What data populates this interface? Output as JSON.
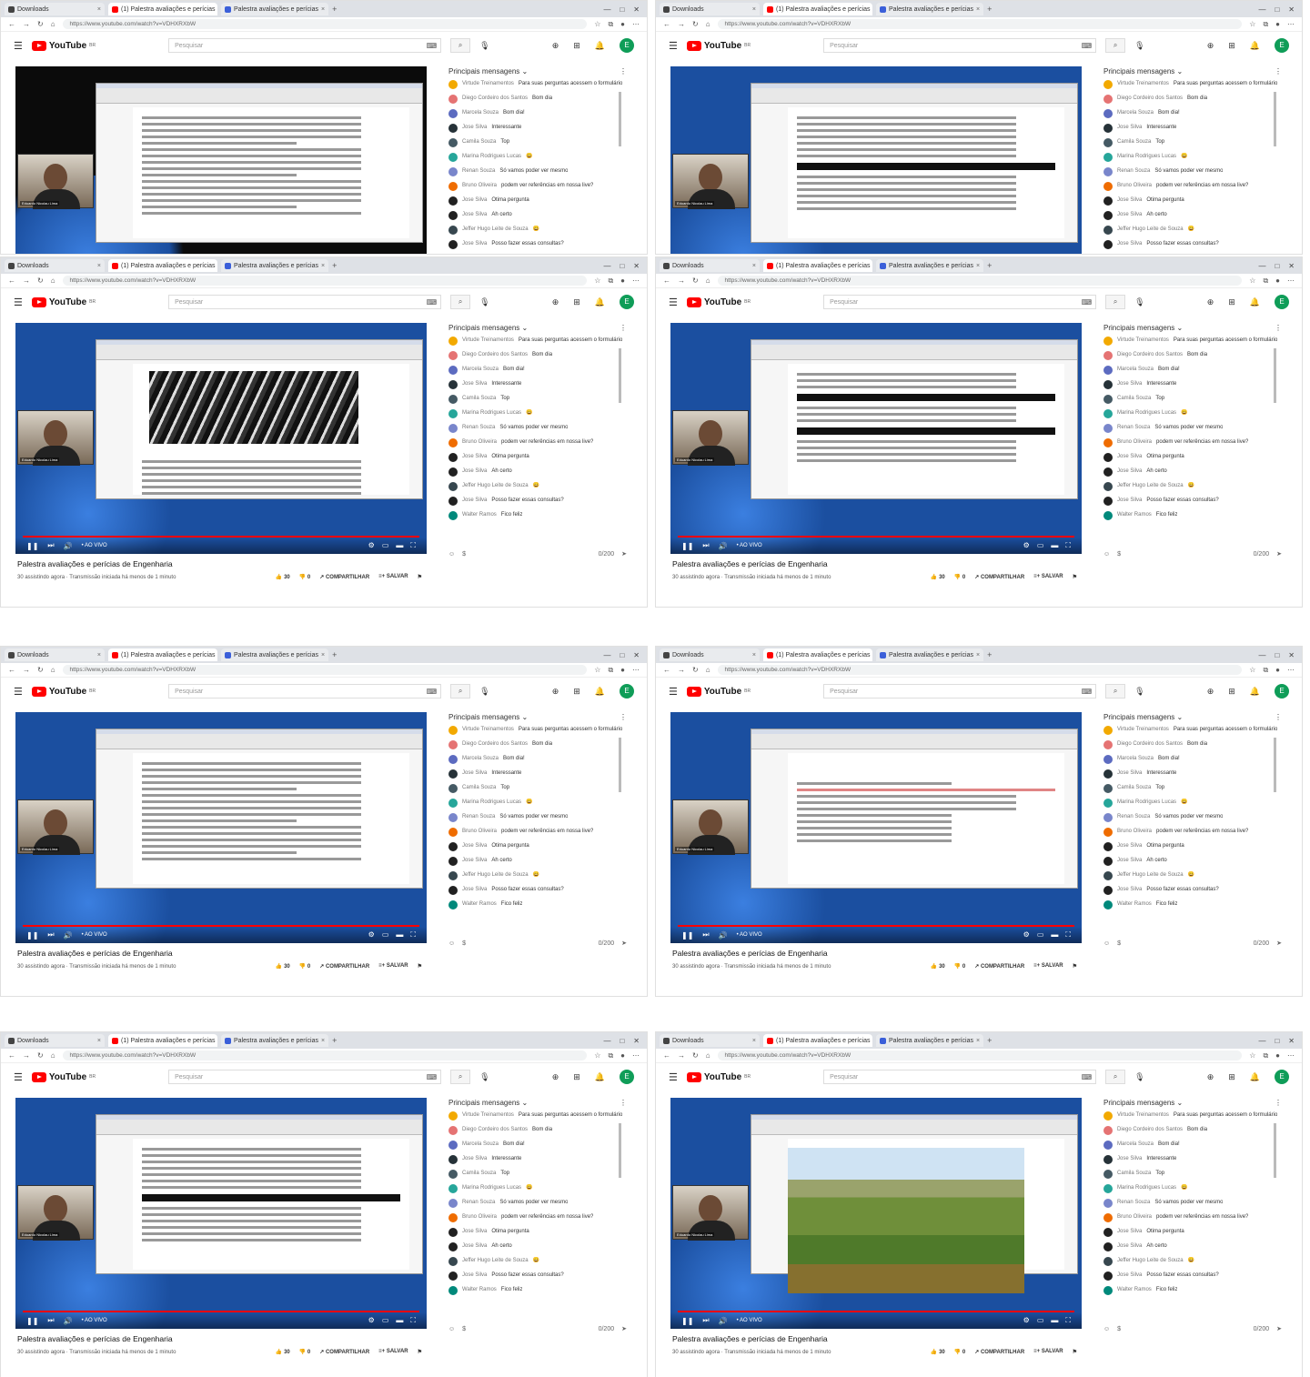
{
  "tabs": [
    {
      "title": "Downloads",
      "color": "#444444"
    },
    {
      "title": "(1) Palestra avaliações e perícias",
      "color": "#ff0000"
    },
    {
      "title": "Palestra avaliações e perícias",
      "color": "#3b5fd9"
    }
  ],
  "address": {
    "url": "https://www.youtube.com/watch?v=VDHXRXbW"
  },
  "youtube": {
    "brand": "YouTube",
    "region": "BR",
    "search_placeholder": "Pesquisar",
    "avatar_letter": "E"
  },
  "chat": {
    "header": "Principais mensagens",
    "input_placeholder": "0/200",
    "messages": [
      {
        "author": "Virtude Treinamentos",
        "text": "Para suas perguntas acessem o formulário",
        "color": "#f2a900"
      },
      {
        "author": "Diego Cordeiro dos Santos",
        "text": "Bom dia",
        "color": "#e57373"
      },
      {
        "author": "Marcela Souza",
        "text": "Bom dia!",
        "color": "#5c6bc0"
      },
      {
        "author": "Jose Silva",
        "text": "Interessante",
        "color": "#263238"
      },
      {
        "author": "Camila Souza",
        "text": "Top",
        "color": "#455a64"
      },
      {
        "author": "Marina Rodrigues Lucas",
        "text": "😀",
        "color": "#26a69a"
      },
      {
        "author": "Renan Souza",
        "text": "Só vamos poder ver mesmo",
        "color": "#7986cb"
      },
      {
        "author": "Bruno Oliveira",
        "text": "podem ver referências em nossa live?",
        "color": "#ef6c00"
      },
      {
        "author": "Jose Silva",
        "text": "Ótima pergunta",
        "color": "#212121"
      },
      {
        "author": "Jose Silva",
        "text": "Ah certo",
        "color": "#212121"
      },
      {
        "author": "Jeffer Hugo Leite de Souza",
        "text": "😀",
        "color": "#37474f"
      },
      {
        "author": "Jose Silva",
        "text": "Posso fazer essas consultas?",
        "color": "#212121"
      },
      {
        "author": "Walter Ramos",
        "text": "Fico feliz",
        "color": "#00897b"
      }
    ]
  },
  "video": {
    "title": "Palestra avaliações e perícias de Engenharia",
    "meta": "30 assistindo agora · Transmissão iniciada há menos de 1 minuto",
    "likes": "30",
    "dislikes": "0",
    "share_label": "COMPARTILHAR",
    "save_label": "SALVAR",
    "presenter_name": "Eduardo Nicolau Lima",
    "time": "• AO VIVO"
  },
  "panels": [
    {
      "kind": "dark",
      "doc": "text"
    },
    {
      "kind": "blue",
      "doc": "text-bar"
    },
    {
      "kind": "blue",
      "doc": "image-bw"
    },
    {
      "kind": "blue",
      "doc": "text-bars"
    },
    {
      "kind": "blue",
      "doc": "text"
    },
    {
      "kind": "blue",
      "doc": "letter"
    },
    {
      "kind": "blue",
      "doc": "text-bar"
    },
    {
      "kind": "blue",
      "doc": "land"
    }
  ]
}
